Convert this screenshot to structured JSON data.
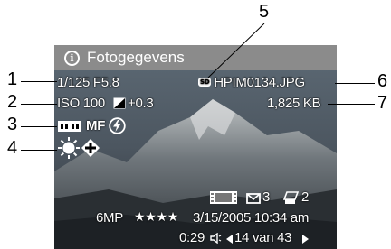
{
  "screen": {
    "title": "Fotogegevens",
    "shutter_aperture": "1/125 F5.8",
    "iso": "ISO 100",
    "exposure_comp": "+0.3",
    "focus_mode": "MF",
    "filename": "HPIM0134.JPG",
    "filesize": "1,825 KB",
    "print_count": "3",
    "share_count": "2",
    "resolution": "6MP",
    "quality_stars": "★★★★",
    "datetime": "3/15/2005 10:34 am",
    "duration": "0:29",
    "image_position": "14 van 43",
    "storage_badge": "SD",
    "icons": [
      "info-icon",
      "sd-card-icon",
      "exposure-comp-icon",
      "metering-icon",
      "flash-off-icon",
      "sun-icon",
      "focus-cross-icon",
      "film-strip-icon",
      "envelope-icon",
      "printer-icon",
      "speaker-icon",
      "left-arrow-icon",
      "right-arrow-icon"
    ]
  },
  "callouts": {
    "c1": "1",
    "c2": "2",
    "c3": "3",
    "c4": "4",
    "c5": "5",
    "c6": "6",
    "c7": "7"
  }
}
